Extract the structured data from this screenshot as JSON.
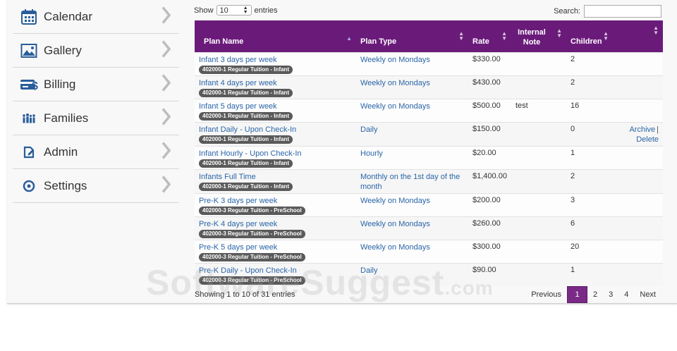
{
  "sidebar": {
    "items": [
      {
        "label": "Calendar",
        "icon": "calendar-icon"
      },
      {
        "label": "Gallery",
        "icon": "gallery-icon"
      },
      {
        "label": "Billing",
        "icon": "billing-icon"
      },
      {
        "label": "Families",
        "icon": "families-icon"
      },
      {
        "label": "Admin",
        "icon": "admin-icon"
      },
      {
        "label": "Settings",
        "icon": "settings-icon"
      }
    ]
  },
  "controls": {
    "show_label": "Show",
    "show_value": "10",
    "entries_label": "entries",
    "search_label": "Search:",
    "search_value": ""
  },
  "table": {
    "headers": [
      "Plan Name",
      "Plan Type",
      "Rate",
      "Internal Note",
      "Children",
      ""
    ],
    "rows": [
      {
        "name": "Infant 3 days per week",
        "badge": "402000-1 Regular Tuition - Infant",
        "type": "Weekly on Mondays",
        "rate": "$330.00",
        "note": "",
        "children": "2"
      },
      {
        "name": "Infant 4 days per week",
        "badge": "402000-1 Regular Tuition - Infant",
        "type": "Weekly on Mondays",
        "rate": "$430.00",
        "note": "",
        "children": "2"
      },
      {
        "name": "Infant 5 days per week",
        "badge": "402000-1 Regular Tuition - Infant",
        "type": "Weekly on Mondays",
        "rate": "$500.00",
        "note": "test",
        "children": "16"
      },
      {
        "name": "Infant Daily - Upon Check-In",
        "badge": "402000-1 Regular Tuition - Infant",
        "type": "Daily",
        "rate": "$150.00",
        "note": "",
        "children": "0",
        "archive": "Archive",
        "sep": "|",
        "delete": "Delete"
      },
      {
        "name": "Infant Hourly - Upon Check-In",
        "badge": "402000-1 Regular Tuition - Infant",
        "type": "Hourly",
        "rate": "$20.00",
        "note": "",
        "children": "1"
      },
      {
        "name": "Infants Full Time",
        "badge": "402000-1 Regular Tuition - Infant",
        "type": "Monthly on the 1st day of the month",
        "rate": "$1,400.00",
        "note": "",
        "children": "2"
      },
      {
        "name": "Pre-K 3 days per week",
        "badge": "402000-3 Regular Tuition - PreSchool",
        "type": "Weekly on Mondays",
        "rate": "$200.00",
        "note": "",
        "children": "3"
      },
      {
        "name": "Pre-K 4 days per week",
        "badge": "402000-3 Regular Tuition - PreSchool",
        "type": "Weekly on Mondays",
        "rate": "$260.00",
        "note": "",
        "children": "6"
      },
      {
        "name": "Pre-K 5 days per week",
        "badge": "402000-3 Regular Tuition - PreSchool",
        "type": "Weekly on Mondays",
        "rate": "$300.00",
        "note": "",
        "children": "20"
      },
      {
        "name": "Pre-K Daily - Upon Check-In",
        "badge": "402000-3 Regular Tuition - PreSchool",
        "type": "Daily",
        "rate": "$90.00",
        "note": "",
        "children": "1"
      }
    ]
  },
  "footer": {
    "showing_text": "Showing 1 to 10 of 31 entries",
    "previous": "Previous",
    "pages": [
      "1",
      "2",
      "3",
      "4"
    ],
    "current_page": "1",
    "next": "Next"
  },
  "watermark": {
    "main": "SoftwareSuggest",
    "suffix": ".com"
  },
  "colors": {
    "header_purple": "#6a1b7a",
    "link_blue": "#2a65a8",
    "badge_gray": "#5a5a5a",
    "active_page": "#7a2a86"
  }
}
